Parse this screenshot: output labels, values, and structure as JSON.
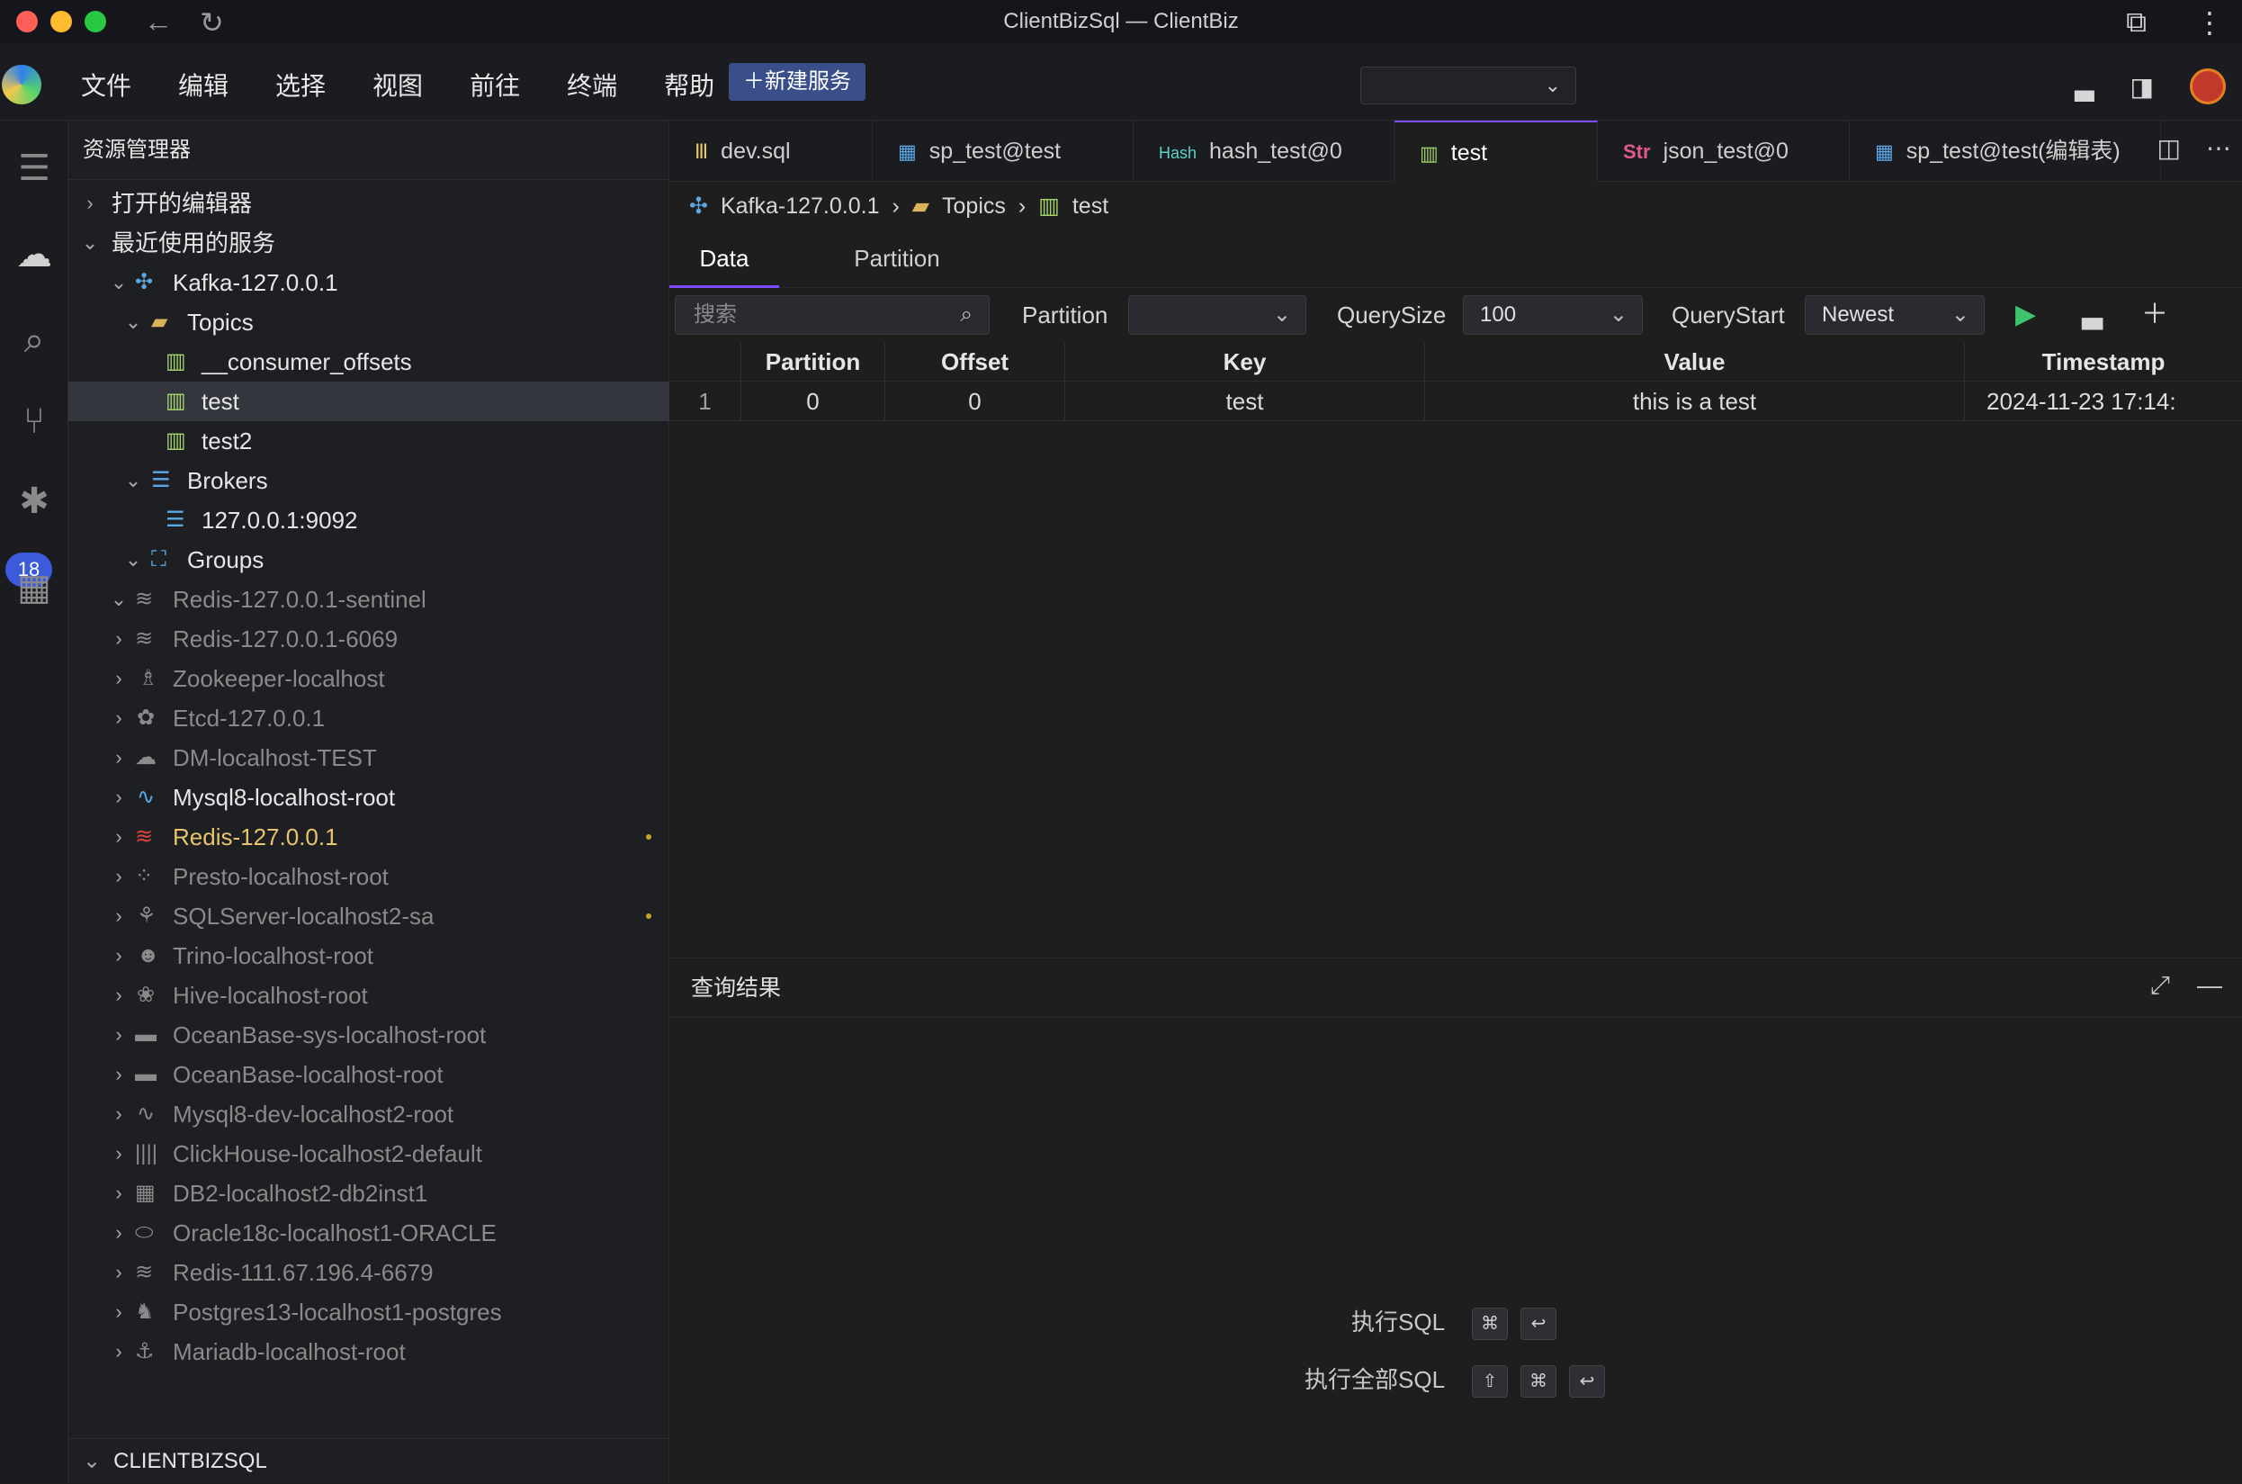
{
  "window": {
    "title": "ClientBizSql — ClientBiz"
  },
  "menu": {
    "items": [
      "文件",
      "编辑",
      "选择",
      "视图",
      "前往",
      "终端",
      "帮助"
    ],
    "new_service": "＋新建服务"
  },
  "activity": {
    "badge": "18"
  },
  "sidebar": {
    "title": "资源管理器",
    "open_editors": "打开的编辑器",
    "recent": "最近使用的服务",
    "kafka": "Kafka-127.0.0.1",
    "topics": "Topics",
    "topic_items": [
      "__consumer_offsets",
      "test",
      "test2"
    ],
    "brokers": "Brokers",
    "broker_items": [
      "127.0.0.1:9092"
    ],
    "groups": "Groups",
    "services": [
      "Redis-127.0.0.1-sentinel",
      "Redis-127.0.0.1-6069",
      "Zookeeper-localhost",
      "Etcd-127.0.0.1",
      "DM-localhost-TEST",
      "Mysql8-localhost-root",
      "Redis-127.0.0.1",
      "Presto-localhost-root",
      "SQLServer-localhost2-sa",
      "Trino-localhost-root",
      "Hive-localhost-root",
      "OceanBase-sys-localhost-root",
      "OceanBase-localhost-root",
      "Mysql8-dev-localhost2-root",
      "ClickHouse-localhost2-default",
      "DB2-localhost2-db2inst1",
      "Oracle18c-localhost1-ORACLE",
      "Redis-111.67.196.4-6679",
      "Postgres13-localhost1-postgres",
      "Mariadb-localhost-root"
    ],
    "footer": "CLIENTBIZSQL"
  },
  "tabs": [
    {
      "icon": "Ⅲ",
      "label": "dev.sql"
    },
    {
      "icon": "▦",
      "label": "sp_test@test"
    },
    {
      "icon": "Hash",
      "label": "hash_test@0"
    },
    {
      "icon": "▥",
      "label": "test"
    },
    {
      "icon": "Str",
      "label": "json_test@0"
    },
    {
      "icon": "▦",
      "label": "sp_test@test(编辑表)"
    }
  ],
  "breadcrumb": {
    "root": "Kafka-127.0.0.1",
    "mid": "Topics",
    "leaf": "test"
  },
  "subtabs": {
    "data": "Data",
    "partition": "Partition"
  },
  "toolbar": {
    "search_placeholder": "搜索",
    "partition_label": "Partition",
    "partition_value": "",
    "querysize_label": "QuerySize",
    "querysize_value": "100",
    "querystart_label": "QueryStart",
    "querystart_value": "Newest"
  },
  "table": {
    "headers": [
      "Partition",
      "Offset",
      "Key",
      "Value",
      "Timestamp"
    ],
    "rows": [
      {
        "index": "1",
        "partition": "0",
        "offset": "0",
        "key": "test",
        "value": "this is a test",
        "timestamp": "2024-11-23 17:14:"
      }
    ]
  },
  "results": {
    "title": "查询结果",
    "run_sql": "执行SQL",
    "run_all_sql": "执行全部SQL",
    "k_cmd": "⌘",
    "k_enter": "↩",
    "k_shift": "⇧"
  }
}
